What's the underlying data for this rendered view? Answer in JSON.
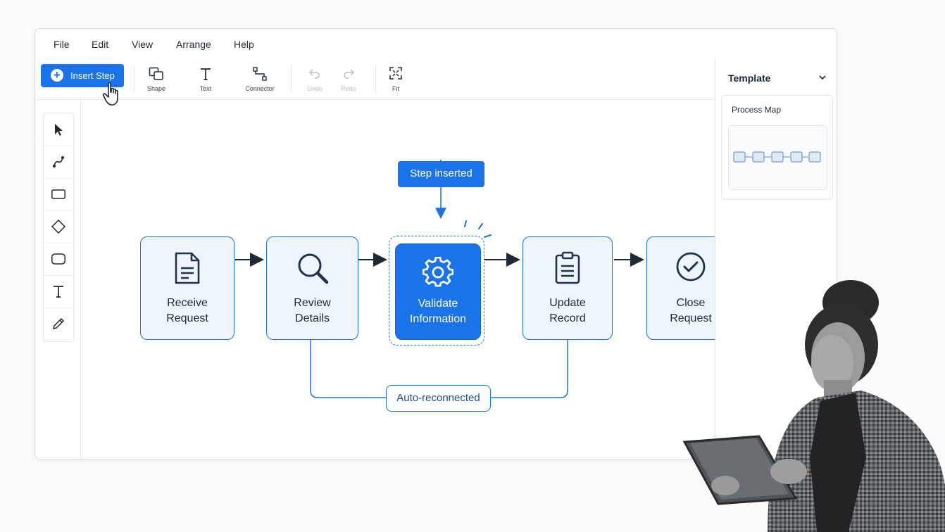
{
  "menu": {
    "items": [
      {
        "label": "File"
      },
      {
        "label": "Edit"
      },
      {
        "label": "View"
      },
      {
        "label": "Arrange"
      },
      {
        "label": "Help"
      }
    ]
  },
  "toolbar": {
    "insert_step_label": "Insert Step",
    "tools": [
      {
        "label": "Shape",
        "icon": "shape-icon"
      },
      {
        "label": "Text",
        "icon": "text-icon"
      },
      {
        "label": "Connector",
        "icon": "connector-icon"
      },
      {
        "label": "Undo",
        "icon": "undo-icon",
        "disabled": true
      },
      {
        "label": "Redo",
        "icon": "redo-icon",
        "disabled": true
      },
      {
        "label": "Fit",
        "icon": "fit-icon"
      }
    ]
  },
  "left_tools": [
    {
      "icon": "pointer-icon"
    },
    {
      "icon": "connector-line-icon"
    },
    {
      "icon": "rectangle-icon"
    },
    {
      "icon": "diamond-icon"
    },
    {
      "icon": "rounded-rectangle-icon"
    },
    {
      "icon": "text-icon"
    },
    {
      "icon": "pen-icon"
    }
  ],
  "template_panel": {
    "title": "Template",
    "card_title": "Process Map"
  },
  "flow": {
    "nodes": [
      {
        "line1": "Receive",
        "line2": "Request",
        "icon": "document-icon"
      },
      {
        "line1": "Review",
        "line2": "Details",
        "icon": "search-icon"
      },
      {
        "line1": "Validate",
        "line2": "Information",
        "icon": "gear-icon",
        "selected": true
      },
      {
        "line1": "Update",
        "line2": "Record",
        "icon": "clipboard-icon"
      },
      {
        "line1": "Close",
        "line2": "Request",
        "icon": "check-circle-icon"
      }
    ],
    "callout": "Step inserted",
    "reconnect_label": "Auto-reconnected"
  },
  "colors": {
    "accent": "#1a73e8",
    "node_fill": "#eef5fd",
    "arrow": "#1f2933"
  }
}
